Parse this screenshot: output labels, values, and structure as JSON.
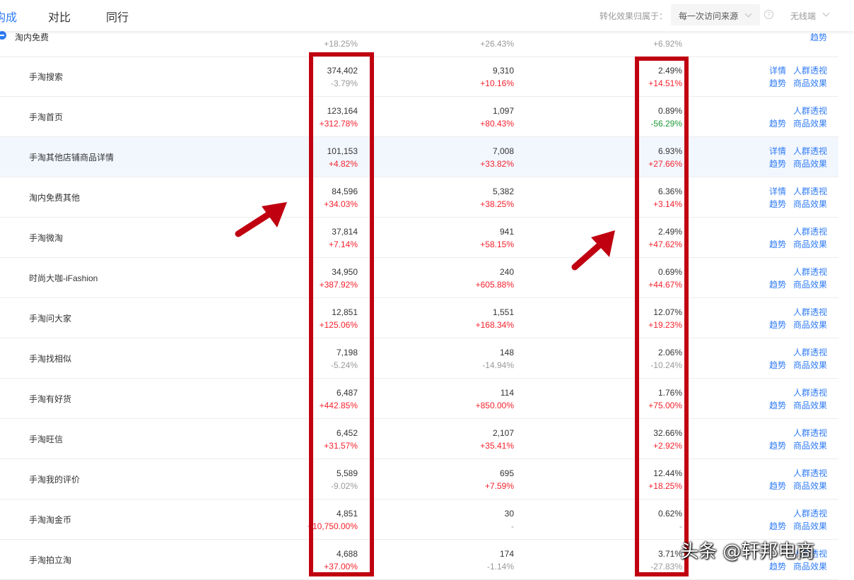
{
  "header": {
    "tabs": [
      "构成",
      "对比",
      "同行"
    ],
    "active_tab_visible_text": "构成",
    "attribution_label": "转化效果归属于：",
    "attribution_value": "每一次访问来源",
    "device_value": "无线端"
  },
  "group": {
    "name": "淘内免费",
    "change1": "+18.25%",
    "change2": "+26.43%",
    "change3": "+6.92%",
    "link": "趋势"
  },
  "links": {
    "detail": "详情",
    "trend": "趋势",
    "crowd": "人群透视",
    "product": "商品效果"
  },
  "rows": [
    {
      "name": "手淘搜索",
      "v1": "374,402",
      "c1": "-3.79%",
      "v2": "9,310",
      "c2": "+10.16%",
      "v3": "2.49%",
      "c3": "+14.51%"
    },
    {
      "name": "手淘首页",
      "v1": "123,164",
      "c1": "+312.78%",
      "v2": "1,097",
      "c2": "+80.43%",
      "v3": "0.89%",
      "c3": "-56.29%"
    },
    {
      "name": "手淘其他店铺商品详情",
      "v1": "101,153",
      "c1": "+4.82%",
      "v2": "7,008",
      "c2": "+33.82%",
      "v3": "6.93%",
      "c3": "+27.66%"
    },
    {
      "name": "淘内免费其他",
      "v1": "84,596",
      "c1": "+34.03%",
      "v2": "5,382",
      "c2": "+38.25%",
      "v3": "6.36%",
      "c3": "+3.14%"
    },
    {
      "name": "手淘微淘",
      "v1": "37,814",
      "c1": "+7.14%",
      "v2": "941",
      "c2": "+58.15%",
      "v3": "2.49%",
      "c3": "+47.62%"
    },
    {
      "name": "时尚大咖-iFashion",
      "v1": "34,950",
      "c1": "+387.92%",
      "v2": "240",
      "c2": "+605.88%",
      "v3": "0.69%",
      "c3": "+44.67%"
    },
    {
      "name": "手淘问大家",
      "v1": "12,851",
      "c1": "+125.06%",
      "v2": "1,551",
      "c2": "+168.34%",
      "v3": "12.07%",
      "c3": "+19.23%"
    },
    {
      "name": "手淘找相似",
      "v1": "7,198",
      "c1": "-5.24%",
      "v2": "148",
      "c2": "-14.94%",
      "v3": "2.06%",
      "c3": "-10.24%"
    },
    {
      "name": "手淘有好货",
      "v1": "6,487",
      "c1": "+442.85%",
      "v2": "114",
      "c2": "+850.00%",
      "v3": "1.76%",
      "c3": "+75.00%"
    },
    {
      "name": "手淘旺信",
      "v1": "6,452",
      "c1": "+31.57%",
      "v2": "2,107",
      "c2": "+35.41%",
      "v3": "32.66%",
      "c3": "+2.92%"
    },
    {
      "name": "手淘我的评价",
      "v1": "5,589",
      "c1": "-9.02%",
      "v2": "695",
      "c2": "+7.59%",
      "v3": "12.44%",
      "c3": "+18.25%"
    },
    {
      "name": "手淘淘金币",
      "v1": "4,851",
      "c1": "+10,750.00%",
      "v2": "30",
      "c2": "-",
      "v3": "0.62%",
      "c3": "-"
    },
    {
      "name": "手淘拍立淘",
      "v1": "4,688",
      "c1": "+37.00%",
      "v2": "174",
      "c2": "-1.14%",
      "v3": "3.71%",
      "c3": "-27.83%"
    }
  ],
  "watermark": "头条 @轩邦电商",
  "colors": {
    "accent": "#2f7bf5",
    "increase": "#f5222d",
    "decrease": "#999999",
    "strong_decrease": "#1f9b3a",
    "annotation": "#c00010"
  }
}
